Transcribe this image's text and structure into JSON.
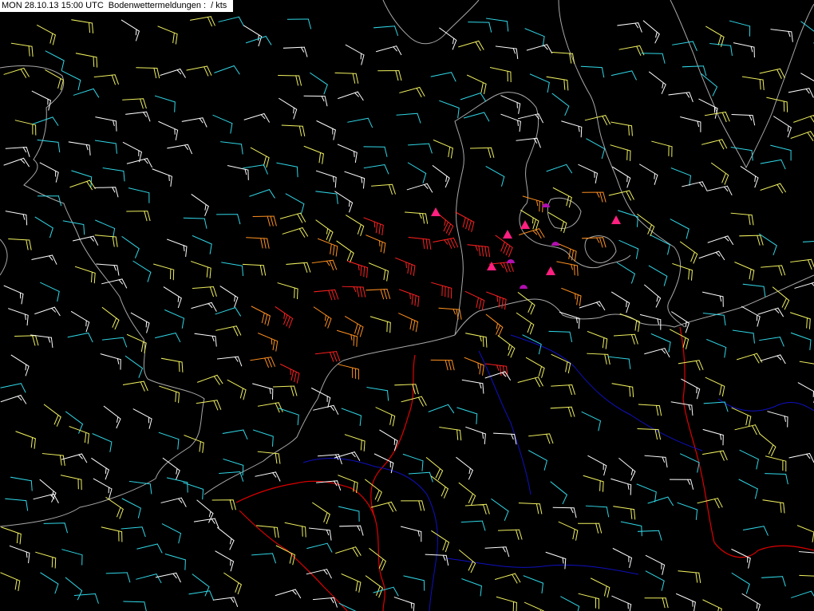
{
  "header": {
    "title": "MON 28.10.13 15:00 UTC",
    "product": "Bodenwettermeldungen :",
    "units": "/ kts"
  },
  "colors": {
    "background": "#000000",
    "coastline": "#a8a8a8",
    "border": "#e00000",
    "river": "#1010c0",
    "front_warm": "#ff2080",
    "front_occluded": "#b010b0",
    "wind_bands": [
      {
        "max_kts": 7,
        "color": "#1b8fe8"
      },
      {
        "max_kts": 12,
        "color": "#30d8e8"
      },
      {
        "max_kts": 17,
        "color": "#ffffff"
      },
      {
        "max_kts": 24,
        "color": "#f0f060"
      },
      {
        "max_kts": 31,
        "color": "#ff9020"
      },
      {
        "max_kts": 99,
        "color": "#ff2020"
      }
    ]
  },
  "fronts": [
    {
      "type": "warm",
      "symbol": "triangle-icon"
    },
    {
      "type": "occluded",
      "symbol": "half-disc-icon"
    }
  ]
}
